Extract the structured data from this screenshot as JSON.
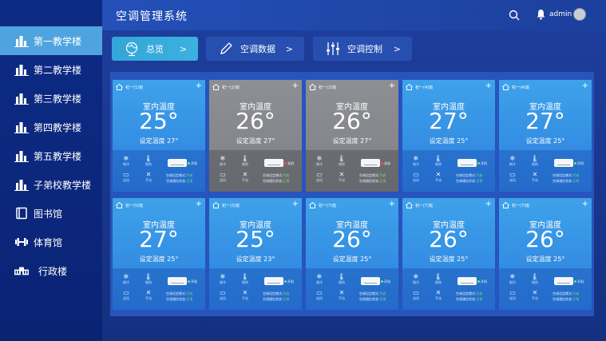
{
  "app": {
    "title": "空调管理系统",
    "user": "admin"
  },
  "sidebar": {
    "items": [
      {
        "label": "第一教学楼",
        "icon": "building-icon",
        "active": true
      },
      {
        "label": "第二教学楼",
        "icon": "building-icon",
        "active": false
      },
      {
        "label": "第三教学楼",
        "icon": "building-icon",
        "active": false
      },
      {
        "label": "第四教学楼",
        "icon": "building-icon",
        "active": false
      },
      {
        "label": "第五教学楼",
        "icon": "building-icon",
        "active": false
      },
      {
        "label": "子弟校教学楼",
        "icon": "building-icon",
        "active": false
      },
      {
        "label": "图书馆",
        "icon": "book-icon",
        "active": false
      },
      {
        "label": "体育馆",
        "icon": "dumbbell-icon",
        "active": false
      },
      {
        "label": "行政楼",
        "icon": "admin-building-icon",
        "active": false
      }
    ]
  },
  "tabs": [
    {
      "label": "总览",
      "icon": "globe-icon",
      "active": true
    },
    {
      "label": "空调数据",
      "icon": "pencil-icon",
      "active": false
    },
    {
      "label": "空调控制",
      "icon": "sliders-icon",
      "active": false
    }
  ],
  "card_labels": {
    "room_temp": "室内温度",
    "set_temp_prefix": "设定温度",
    "ctl_cool": "制冷",
    "ctl_heat": "制热",
    "ctl_screen": "送风",
    "ctl_manual": "手动",
    "mode_label": "空调设定模式:",
    "mode_value": "开启",
    "comm_label": "空调通信状态:",
    "comm_value": "正常"
  },
  "colors": {
    "on": "#3ea2ea",
    "off": "#8d8f94",
    "power_on": "#6fe57a",
    "power_off": "#ff4d4f"
  },
  "cards": [
    {
      "room": "初一(1)班",
      "temp": "25°",
      "set": "27°",
      "power": "开机",
      "on": true
    },
    {
      "room": "初一(2)班",
      "temp": "26°",
      "set": "27°",
      "power": "关机",
      "on": false
    },
    {
      "room": "初一(2)班",
      "temp": "26°",
      "set": "27°",
      "power": "关机",
      "on": false
    },
    {
      "room": "初一(4)班",
      "temp": "27°",
      "set": "25°",
      "power": "开机",
      "on": true
    },
    {
      "room": "初一(4)班",
      "temp": "27°",
      "set": "25°",
      "power": "开机",
      "on": true
    },
    {
      "room": "初一(5)班",
      "temp": "27°",
      "set": "25°",
      "power": "开机",
      "on": true
    },
    {
      "room": "初一(5)班",
      "temp": "25°",
      "set": "23°",
      "power": "开机",
      "on": true
    },
    {
      "room": "初一(7)班",
      "temp": "26°",
      "set": "25°",
      "power": "开机",
      "on": true
    },
    {
      "room": "初一(7)班",
      "temp": "26°",
      "set": "25°",
      "power": "开机",
      "on": true
    },
    {
      "room": "初一(7)班",
      "temp": "26°",
      "set": "25°",
      "power": "开机",
      "on": true
    }
  ]
}
